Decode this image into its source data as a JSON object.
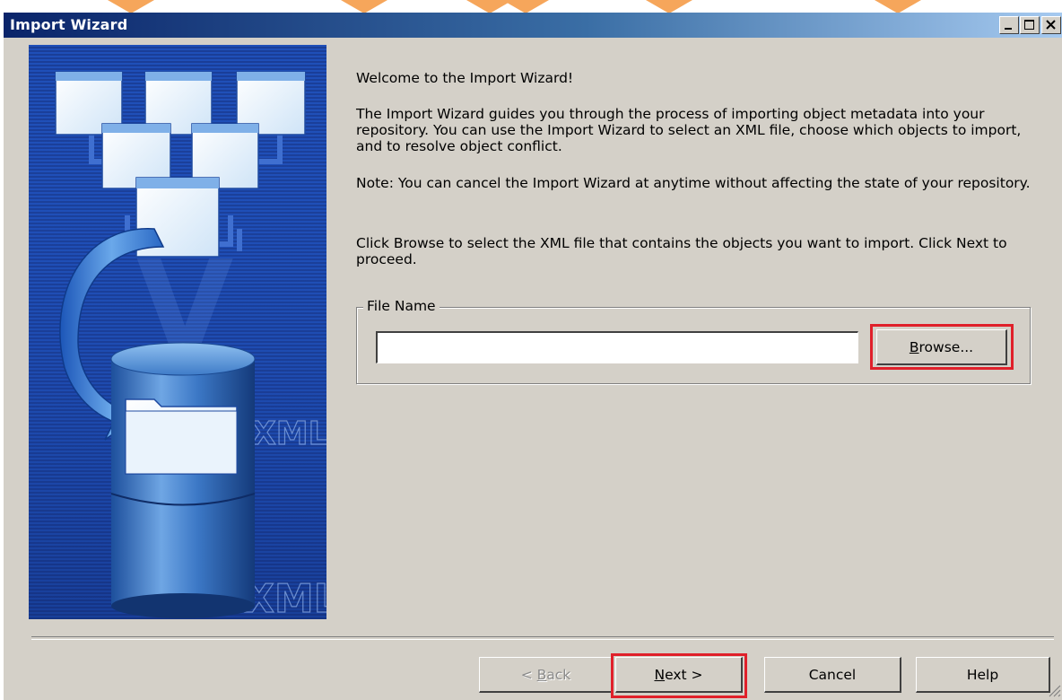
{
  "window": {
    "title": "Import Wizard"
  },
  "banner": {
    "watermark_1": "XML",
    "watermark_2": "XML"
  },
  "content": {
    "welcome": "Welcome to the Import Wizard!",
    "description": "The Import Wizard guides you through the process of importing object metadata into your repository. You can use the Import Wizard to select an XML file, choose which objects to import, and to resolve object conflict.",
    "note": "Note: You can cancel the Import Wizard at anytime without affecting the state of your repository.",
    "instructions": "Click Browse to select the XML file that contains the objects you want to import. Click Next to proceed."
  },
  "file_group": {
    "label": "File Name",
    "value": "",
    "browse_mnemonic": "B",
    "browse_rest": "rowse..."
  },
  "buttons": {
    "back_prefix": "< ",
    "back_mnemonic": "B",
    "back_rest": "ack",
    "next_mnemonic": "N",
    "next_rest": "ext >",
    "cancel": "Cancel",
    "help": "Help"
  },
  "colors": {
    "highlight": "#e0202a",
    "dialog_bg": "#d4d0c8",
    "titlebar_start": "#0a246a",
    "accent_strip": "#f6a65b"
  }
}
